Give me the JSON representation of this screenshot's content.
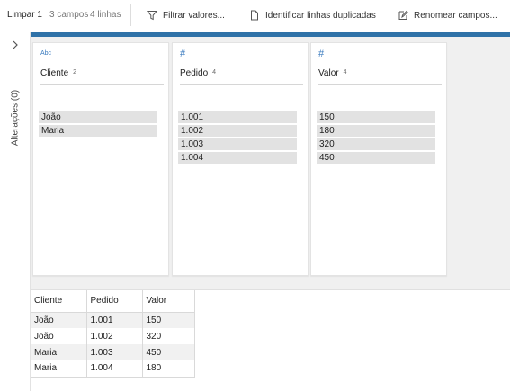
{
  "toolbar": {
    "step_name": "Limpar 1",
    "field_count": "3 campos",
    "row_count": "4 linhas",
    "filter_label": "Filtrar valores...",
    "duplicates_label": "Identificar linhas duplicadas",
    "rename_label": "Renomear campos...",
    "accent_color": "#2f72a8"
  },
  "sidebar": {
    "changes_label": "Alterações (0)",
    "expand_icon": "chevron-right-icon"
  },
  "cards": [
    {
      "type_label": "Abc",
      "type_icon": "string-type-icon",
      "name": "Cliente",
      "count": "2",
      "values": [
        "João",
        "Maria"
      ]
    },
    {
      "type_label": "#",
      "type_icon": "number-type-icon",
      "name": "Pedido",
      "count": "4",
      "values": [
        "1.001",
        "1.002",
        "1.003",
        "1.004"
      ]
    },
    {
      "type_label": "#",
      "type_icon": "number-type-icon",
      "name": "Valor",
      "count": "4",
      "values": [
        "150",
        "180",
        "320",
        "450"
      ]
    }
  ],
  "grid": {
    "headers": [
      "Cliente",
      "Pedido",
      "Valor"
    ],
    "rows": [
      [
        "João",
        "1.001",
        "150"
      ],
      [
        "João",
        "1.002",
        "320"
      ],
      [
        "Maria",
        "1.003",
        "450"
      ],
      [
        "Maria",
        "1.004",
        "180"
      ]
    ]
  }
}
